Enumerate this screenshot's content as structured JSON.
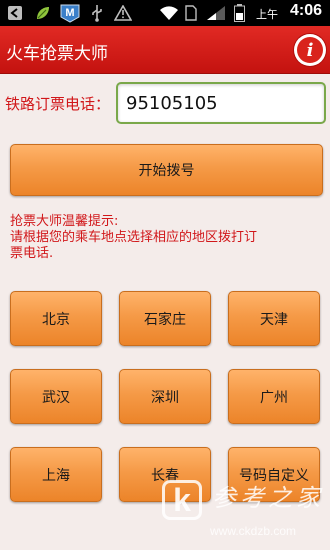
{
  "status_bar": {
    "icons": [
      "back-arrow-icon",
      "leaf-icon",
      "maxthon-m-icon",
      "usb-icon",
      "warning-icon",
      "wifi-icon",
      "sim-icon",
      "signal-icon",
      "battery-icon"
    ],
    "am_pm": "上午",
    "time": "4:06"
  },
  "header": {
    "title": "火车抢票大师",
    "info_icon": "info-icon",
    "colors": {
      "bar": "#d81e1a"
    }
  },
  "phone": {
    "label": "铁路订票电话：",
    "value": "95105105"
  },
  "dial_button": "开始拨号",
  "tips": {
    "line1": "抢票大师温馨提示:",
    "line2": "请根据您的乘车地点选择相应的地区拨打订",
    "line3": "票电话."
  },
  "cities": [
    "北京",
    "石家庄",
    "天津",
    "武汉",
    "深圳",
    "广州",
    "上海",
    "长春",
    "号码自定义"
  ],
  "watermark": {
    "letter": "k",
    "text": "参考之家",
    "url": "www.ckdzb.com"
  },
  "colors": {
    "accent_red": "#d1171a",
    "button_orange": "#f59a47",
    "input_border": "#7aa84a",
    "background": "#f4ecea"
  }
}
